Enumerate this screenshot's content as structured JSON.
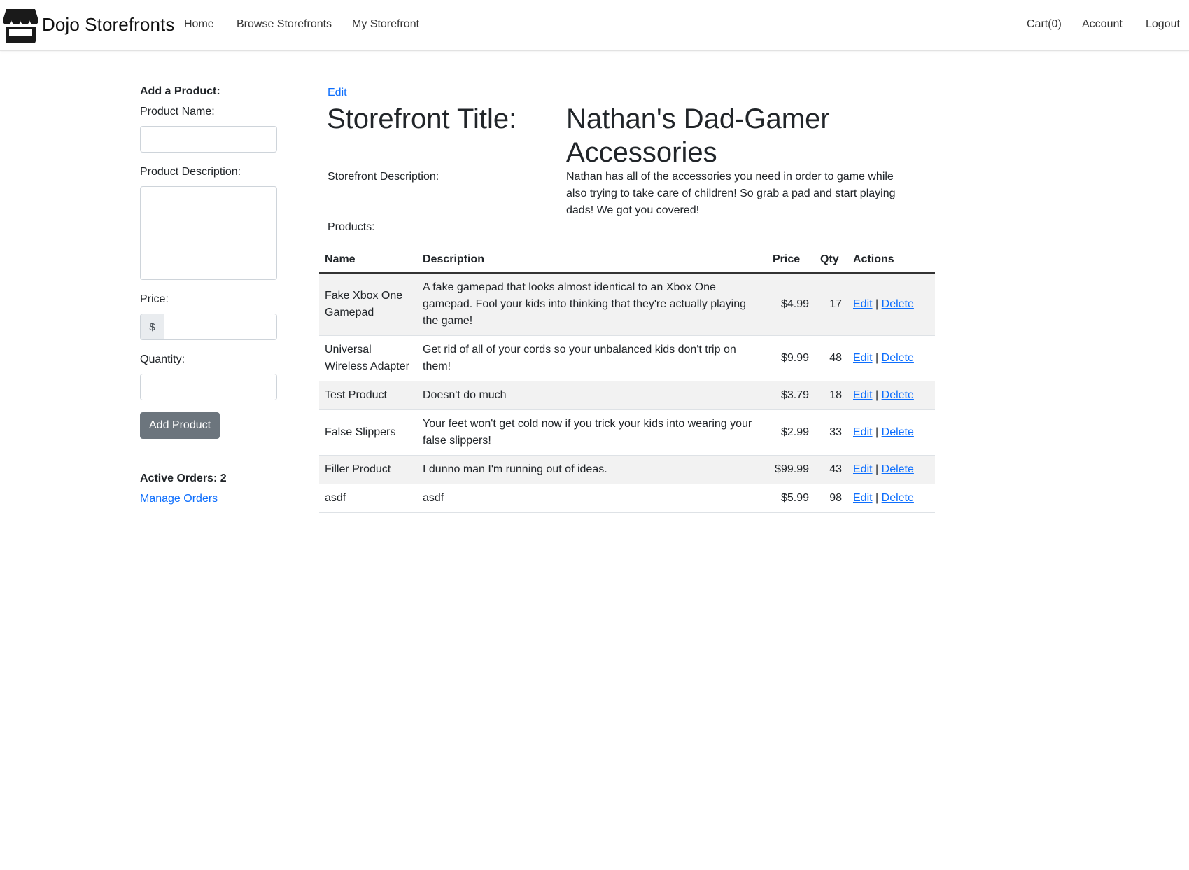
{
  "navbar": {
    "brand": "Dojo Storefronts",
    "brand_icon": "storefront-icon",
    "links": {
      "home": "Home",
      "browse": "Browse Storefronts",
      "my_storefront": "My Storefront",
      "cart": "Cart(0)",
      "account": "Account",
      "logout": "Logout"
    }
  },
  "add_product": {
    "heading": "Add a Product:",
    "name_label": "Product Name:",
    "description_label": "Product Description:",
    "price_label": "Price:",
    "currency_symbol": "$",
    "quantity_label": "Quantity:",
    "submit_label": "Add Product"
  },
  "orders": {
    "active_label": "Active Orders: 2",
    "manage_link": "Manage Orders"
  },
  "storefront": {
    "edit_link": "Edit",
    "title_label": "Storefront Title:",
    "title_line1": "Nathan's Dad-Gamer",
    "title_line2": "Accessories",
    "description_label": "Storefront Description:",
    "description_line1": "Nathan has all of the accessories you need in order to game while",
    "description_line2": "also trying to take care of children! So grab a pad and start playing",
    "description_line3": "dads! We got you covered!",
    "products_label": "Products:"
  },
  "table": {
    "headers": {
      "name": "Name",
      "description": "Description",
      "price": "Price",
      "qty": "Qty",
      "actions": "Actions"
    },
    "edit_label": "Edit",
    "separator": "|",
    "delete_label": "Delete",
    "rows": [
      {
        "name": "Fake Xbox One Gamepad",
        "description": "A fake gamepad that looks almost identical to an Xbox One gamepad. Fool your kids into thinking that they're actually playing the game!",
        "price": "$4.99",
        "qty": "17"
      },
      {
        "name": "Universal Wireless Adapter",
        "description": "Get rid of all of your cords so your unbalanced kids don't trip on them!",
        "price": "$9.99",
        "qty": "48"
      },
      {
        "name": "Test Product",
        "description": "Doesn't do much",
        "price": "$3.79",
        "qty": "18"
      },
      {
        "name": "False Slippers",
        "description": "Your feet won't get cold now if you trick your kids into wearing your false slippers!",
        "price": "$2.99",
        "qty": "33"
      },
      {
        "name": "Filler Product",
        "description": "I dunno man I'm running out of ideas.",
        "price": "$99.99",
        "qty": "43"
      },
      {
        "name": "asdf",
        "description": "asdf",
        "price": "$5.99",
        "qty": "98"
      }
    ]
  }
}
